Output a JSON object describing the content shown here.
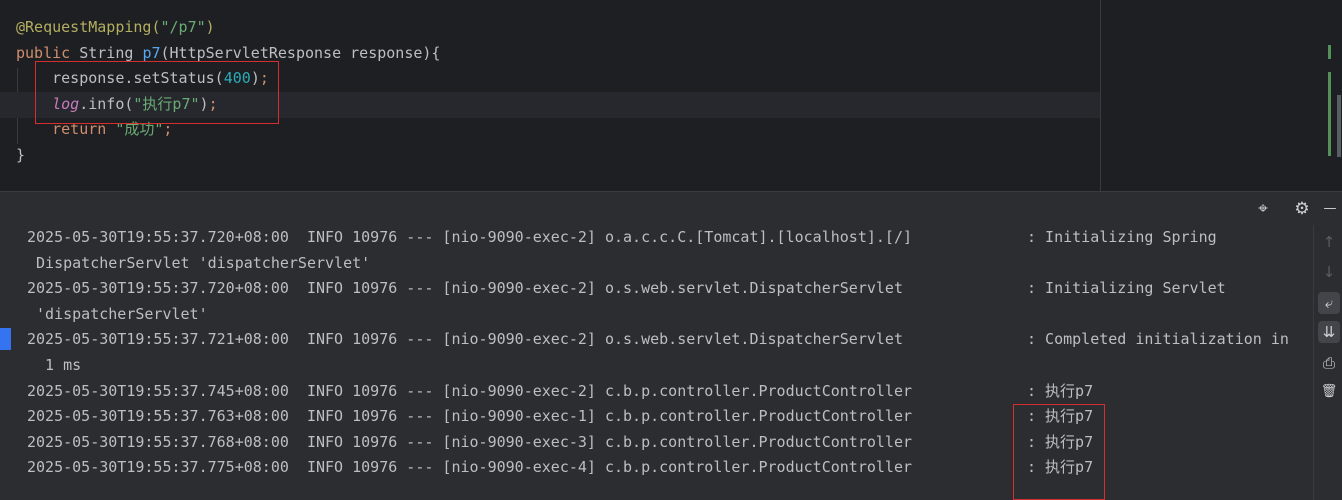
{
  "editor": {
    "lines": [
      {
        "segments": [
          {
            "cls": "t-ann",
            "text": "@RequestMapping("
          },
          {
            "cls": "t-str",
            "text": "\"/p7\""
          },
          {
            "cls": "t-ann",
            "text": ")"
          }
        ]
      },
      {
        "segments": [
          {
            "cls": "t-kw",
            "text": "public "
          },
          {
            "cls": "t-def",
            "text": "String "
          },
          {
            "cls": "t-fn",
            "text": "p7"
          },
          {
            "cls": "t-def",
            "text": "(HttpServletResponse response){"
          }
        ]
      },
      {
        "segments": [
          {
            "cls": "t-def",
            "text": "    response.setStatus("
          },
          {
            "cls": "t-num",
            "text": "400"
          },
          {
            "cls": "t-def",
            "text": ")"
          },
          {
            "cls": "t-kw",
            "text": ";"
          }
        ]
      },
      {
        "segments": [
          {
            "cls": "t-def",
            "text": "    "
          },
          {
            "cls": "t-log",
            "text": "log"
          },
          {
            "cls": "t-def",
            "text": ".info("
          },
          {
            "cls": "t-str",
            "text": "\"执行p7\""
          },
          {
            "cls": "t-def",
            "text": ")"
          },
          {
            "cls": "t-kw",
            "text": ";"
          }
        ]
      },
      {
        "segments": [
          {
            "cls": "t-kw",
            "text": "    return "
          },
          {
            "cls": "t-str",
            "text": "\"成功\""
          },
          {
            "cls": "t-kw",
            "text": ";"
          }
        ]
      },
      {
        "segments": [
          {
            "cls": "t-def",
            "text": "}"
          }
        ]
      }
    ]
  },
  "console": {
    "entries": [
      {
        "main": "2025-05-30T19:55:37.720+08:00  INFO 10976 --- [nio-9090-exec-2] o.a.c.c.C.[Tomcat].[localhost].[/]",
        "msg": ": Initializing Spring",
        "cont": " DispatcherServlet 'dispatcherServlet'"
      },
      {
        "main": "2025-05-30T19:55:37.720+08:00  INFO 10976 --- [nio-9090-exec-2] o.s.web.servlet.DispatcherServlet",
        "msg": ": Initializing Servlet",
        "cont": " 'dispatcherServlet'"
      },
      {
        "main": "2025-05-30T19:55:37.721+08:00  INFO 10976 --- [nio-9090-exec-2] o.s.web.servlet.DispatcherServlet",
        "msg": ": Completed initialization in",
        "cont": "  1 ms"
      },
      {
        "main": "2025-05-30T19:55:37.745+08:00  INFO 10976 --- [nio-9090-exec-2] c.b.p.controller.ProductController",
        "msg": ": 执行p7",
        "cont": ""
      },
      {
        "main": "2025-05-30T19:55:37.763+08:00  INFO 10976 --- [nio-9090-exec-1] c.b.p.controller.ProductController",
        "msg": ": 执行p7",
        "cont": ""
      },
      {
        "main": "2025-05-30T19:55:37.768+08:00  INFO 10976 --- [nio-9090-exec-3] c.b.p.controller.ProductController",
        "msg": ": 执行p7",
        "cont": ""
      },
      {
        "main": "2025-05-30T19:55:37.775+08:00  INFO 10976 --- [nio-9090-exec-4] c.b.p.controller.ProductController",
        "msg": ": 执行p7",
        "cont": ""
      }
    ]
  },
  "toolbar": {
    "target_icon": "⌖",
    "settings_icon": "⚙",
    "minimize_icon": "—"
  },
  "side_toolbar": {
    "up_icon": "↑",
    "down_icon": "↓",
    "wrap_icon": "⤶",
    "scroll_end_icon": "⇊",
    "print_icon": "⎙",
    "trash_icon": "🗑"
  },
  "colors": {
    "highlight": "#d32f2f",
    "accent": "#3574f0"
  }
}
